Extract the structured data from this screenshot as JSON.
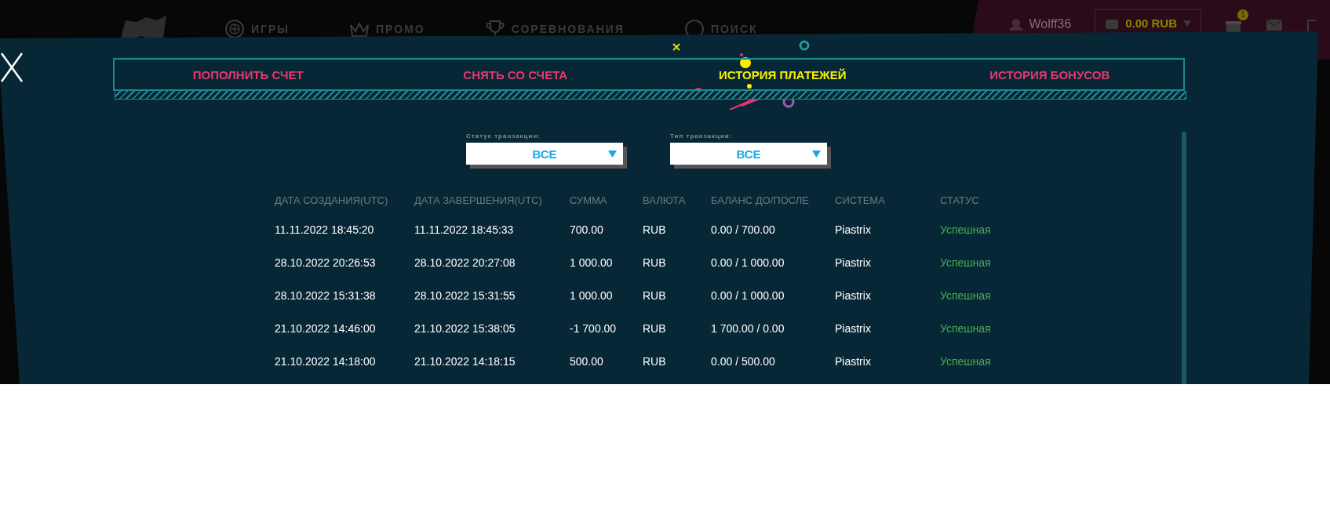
{
  "header": {
    "nav": [
      {
        "kind": "roulette",
        "label": "ИГРЫ"
      },
      {
        "kind": "crown",
        "label": "ПРОМО"
      },
      {
        "kind": "trophy",
        "label": "СОРЕВНОВАНИЯ"
      },
      {
        "kind": "search",
        "label": "ПОИСК"
      }
    ],
    "user": {
      "name": "Wolff36"
    },
    "balance": "0.00 RUB",
    "gift_badge": "1"
  },
  "modal": {
    "tabs": [
      {
        "label": "ПОПОЛНИТЬ СЧЕТ",
        "selected": false
      },
      {
        "label": "СНЯТЬ СО СЧЕТА",
        "selected": false
      },
      {
        "label": "ИСТОРИЯ ПЛАТЕЖЕЙ",
        "selected": true
      },
      {
        "label": "ИСТОРИЯ БОНУСОВ",
        "selected": false
      }
    ],
    "filters": [
      {
        "label": "Статус транзакции:",
        "value": "ВСЕ"
      },
      {
        "label": "Тип транзакции:",
        "value": "ВСЕ"
      }
    ],
    "table": {
      "columns": [
        "ДАТА СОЗДАНИЯ(UTC)",
        "ДАТА ЗАВЕРШЕНИЯ(UTC)",
        "СУММА",
        "ВАЛЮТА",
        "БАЛАНС ДО/ПОСЛЕ",
        "СИСТЕМА",
        "СТАТУС"
      ],
      "rows": [
        [
          "11.11.2022 18:45:20",
          "11.11.2022 18:45:33",
          "700.00",
          "RUB",
          "0.00 / 700.00",
          "Piastrix",
          "Успешная"
        ],
        [
          "28.10.2022 20:26:53",
          "28.10.2022 20:27:08",
          "1 000.00",
          "RUB",
          "0.00 / 1 000.00",
          "Piastrix",
          "Успешная"
        ],
        [
          "28.10.2022 15:31:38",
          "28.10.2022 15:31:55",
          "1 000.00",
          "RUB",
          "0.00 / 1 000.00",
          "Piastrix",
          "Успешная"
        ],
        [
          "21.10.2022 14:46:00",
          "21.10.2022 15:38:05",
          "-1 700.00",
          "RUB",
          "1 700.00 / 0.00",
          "Piastrix",
          "Успешная"
        ],
        [
          "21.10.2022 14:18:00",
          "21.10.2022 14:18:15",
          "500.00",
          "RUB",
          "0.00 / 500.00",
          "Piastrix",
          "Успешная"
        ]
      ]
    }
  }
}
